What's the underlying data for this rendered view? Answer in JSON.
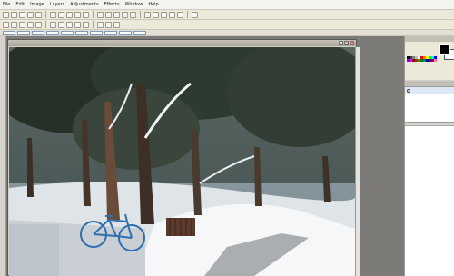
{
  "menubar": {
    "items": [
      "File",
      "Edit",
      "Image",
      "Layers",
      "Adjustments",
      "Effects",
      "Window",
      "Help"
    ]
  },
  "toolbar": {
    "row1_tools": [
      "new",
      "open",
      "save",
      "print",
      "cut",
      "copy",
      "paste",
      "undo",
      "redo",
      "crop",
      "resize",
      "rotate",
      "zoom-in",
      "zoom-out",
      "grid",
      "ruler",
      "pointer",
      "select",
      "lasso",
      "move",
      "wand"
    ],
    "row2_tools": [
      "brush",
      "pen",
      "eraser",
      "fill",
      "gradient",
      "text",
      "shape",
      "line",
      "clone",
      "recolor",
      "picker",
      "zoom",
      "hand"
    ]
  },
  "tool_options": {},
  "image_window": {
    "title": "",
    "minimize_glyph": "_",
    "maximize_glyph": "□",
    "close_glyph": "×"
  },
  "colors_panel": {
    "title": "",
    "primary_color": "#000000",
    "secondary_color": "#ffffff",
    "palette": [
      "#000000",
      "#404040",
      "#808080",
      "#c0c0c0",
      "#ffffff",
      "#ff0000",
      "#ff8000",
      "#ffff00",
      "#00ff00",
      "#00ffff",
      "#0000ff",
      "#8000ff",
      "#ff00ff",
      "#800000",
      "#804000",
      "#808000",
      "#008000",
      "#008080",
      "#000080",
      "#400080",
      "#800080",
      "#ff8080"
    ]
  },
  "layers_panel": {
    "title": "",
    "layers": [
      ""
    ]
  },
  "colors": {
    "workspace": "#7c7b77",
    "chrome": "#ece9d8"
  }
}
